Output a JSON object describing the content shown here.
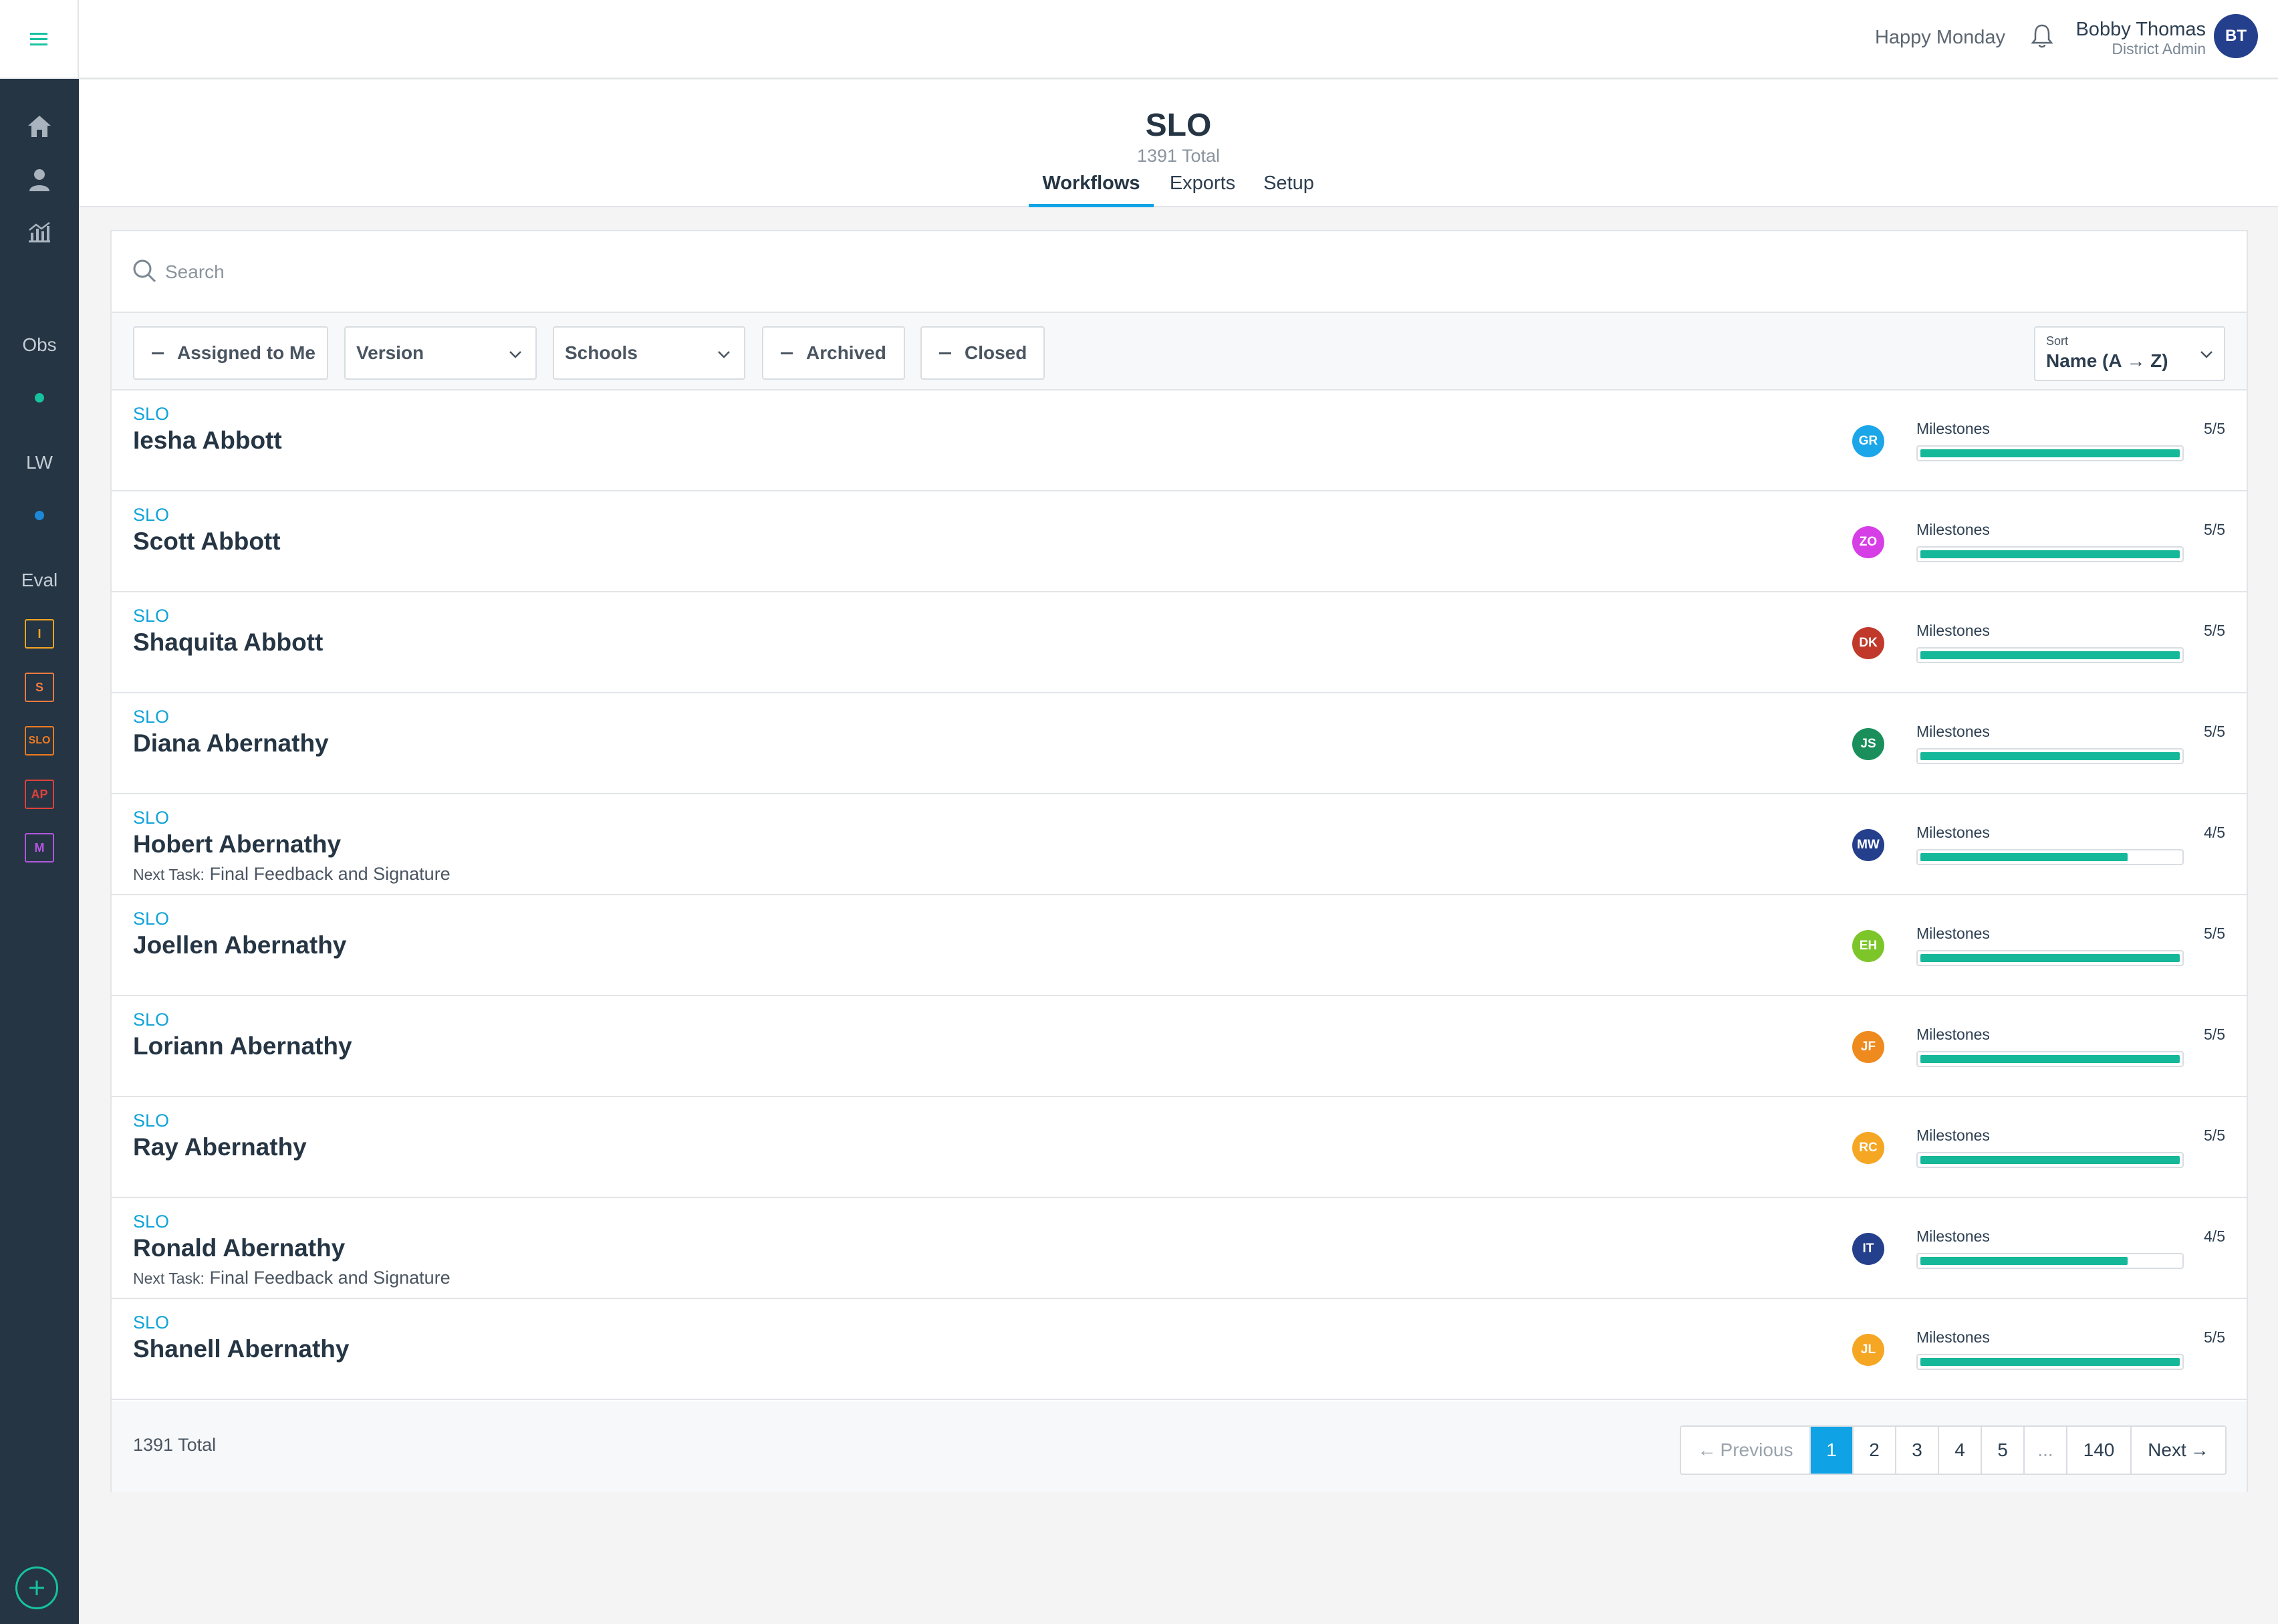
{
  "colors": {
    "accent": "#0fa3e6",
    "progress": "#16b89a",
    "sidebar": "#253544"
  },
  "sidebar": {
    "menu_icon": "hamburger-icon",
    "nav": [
      {
        "icon": "home-icon"
      },
      {
        "icon": "person-icon"
      },
      {
        "icon": "analytics-icon"
      }
    ],
    "sections": [
      {
        "label": "Obs",
        "dot_color": "#16c2a0"
      },
      {
        "label": "LW",
        "dot_color": "#1e88d8"
      },
      {
        "label": "Eval"
      }
    ],
    "eval_items": [
      {
        "label": "I",
        "color": "#f5a623"
      },
      {
        "label": "S",
        "color": "#f07b3f"
      },
      {
        "label": "SLO",
        "color": "#f07b1f"
      },
      {
        "label": "AP",
        "color": "#e0413b"
      },
      {
        "label": "M",
        "color": "#b455e0"
      }
    ],
    "add_icon": "plus-circle-icon"
  },
  "topbar": {
    "greeting": "Happy Monday",
    "bell_icon": "bell-icon",
    "user_name": "Bobby Thomas",
    "user_role": "District Admin",
    "user_initials": "BT"
  },
  "header": {
    "title": "SLO",
    "total": "1391 Total",
    "tabs": [
      {
        "label": "Workflows",
        "active": true
      },
      {
        "label": "Exports",
        "active": false
      },
      {
        "label": "Setup",
        "active": false
      }
    ]
  },
  "search": {
    "placeholder": "Search",
    "value": ""
  },
  "filters": {
    "assigned": "Assigned to Me",
    "version": "Version",
    "schools": "Schools",
    "archived": "Archived",
    "closed": "Closed",
    "sort_label": "Sort",
    "sort_value": "Name (A → Z)"
  },
  "rows": [
    {
      "type": "SLO",
      "name": "Iesha Abbott",
      "initials": "GR",
      "avatar_color": "#1aa6e8",
      "milestones_label": "Milestones",
      "milestones": "5/5",
      "progress": 1.0,
      "next_task_label": "",
      "next_task": ""
    },
    {
      "type": "SLO",
      "name": "Scott Abbott",
      "initials": "ZO",
      "avatar_color": "#d63fe6",
      "milestones_label": "Milestones",
      "milestones": "5/5",
      "progress": 1.0,
      "next_task_label": "",
      "next_task": ""
    },
    {
      "type": "SLO",
      "name": "Shaquita Abbott",
      "initials": "DK",
      "avatar_color": "#c0392b",
      "milestones_label": "Milestones",
      "milestones": "5/5",
      "progress": 1.0,
      "next_task_label": "",
      "next_task": ""
    },
    {
      "type": "SLO",
      "name": "Diana Abernathy",
      "initials": "JS",
      "avatar_color": "#1a8f5c",
      "milestones_label": "Milestones",
      "milestones": "5/5",
      "progress": 1.0,
      "next_task_label": "",
      "next_task": ""
    },
    {
      "type": "SLO",
      "name": "Hobert Abernathy",
      "initials": "MW",
      "avatar_color": "#243f8c",
      "milestones_label": "Milestones",
      "milestones": "4/5",
      "progress": 0.8,
      "next_task_label": "Next Task:",
      "next_task": "Final Feedback and Signature"
    },
    {
      "type": "SLO",
      "name": "Joellen Abernathy",
      "initials": "EH",
      "avatar_color": "#7cc62a",
      "milestones_label": "Milestones",
      "milestones": "5/5",
      "progress": 1.0,
      "next_task_label": "",
      "next_task": ""
    },
    {
      "type": "SLO",
      "name": "Loriann Abernathy",
      "initials": "JF",
      "avatar_color": "#ee8a1e",
      "milestones_label": "Milestones",
      "milestones": "5/5",
      "progress": 1.0,
      "next_task_label": "",
      "next_task": ""
    },
    {
      "type": "SLO",
      "name": "Ray Abernathy",
      "initials": "RC",
      "avatar_color": "#f5a623",
      "milestones_label": "Milestones",
      "milestones": "5/5",
      "progress": 1.0,
      "next_task_label": "",
      "next_task": ""
    },
    {
      "type": "SLO",
      "name": "Ronald Abernathy",
      "initials": "IT",
      "avatar_color": "#243f8c",
      "milestones_label": "Milestones",
      "milestones": "4/5",
      "progress": 0.8,
      "next_task_label": "Next Task:",
      "next_task": "Final Feedback and Signature"
    },
    {
      "type": "SLO",
      "name": "Shanell Abernathy",
      "initials": "JL",
      "avatar_color": "#f5a623",
      "milestones_label": "Milestones",
      "milestones": "5/5",
      "progress": 1.0,
      "next_task_label": "",
      "next_task": ""
    }
  ],
  "footer": {
    "total": "1391 Total",
    "previous": "Previous",
    "next": "Next",
    "pages": [
      "1",
      "2",
      "3",
      "4",
      "5",
      "...",
      "140"
    ],
    "current_page": "1"
  }
}
